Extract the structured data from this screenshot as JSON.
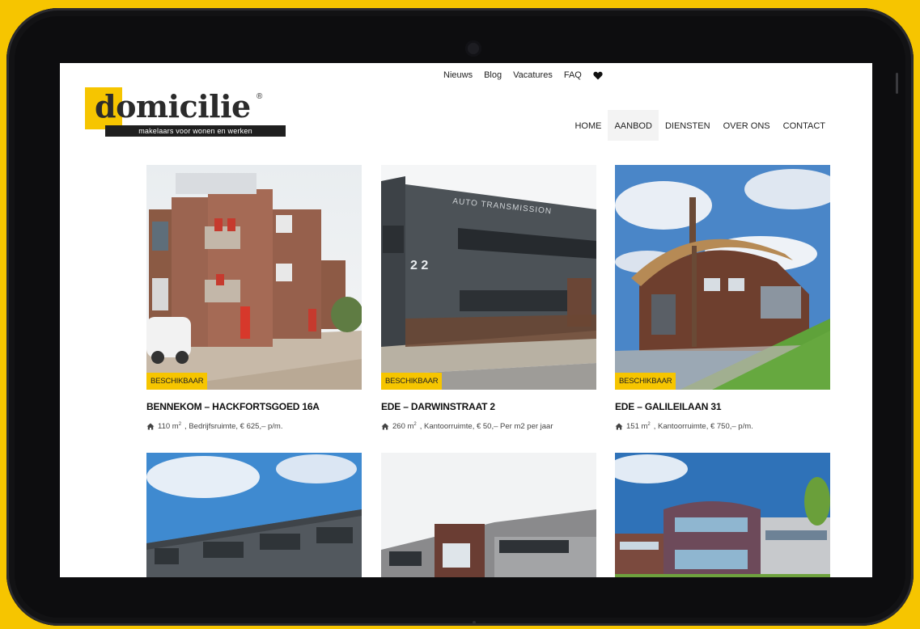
{
  "topnav": [
    {
      "label": "Nieuws"
    },
    {
      "label": "Blog"
    },
    {
      "label": "Vacatures"
    },
    {
      "label": "FAQ"
    }
  ],
  "logo": {
    "word": "domicilie",
    "registered": "®",
    "tagline": "makelaars voor wonen en werken"
  },
  "mainnav": [
    {
      "label": "HOME",
      "active": false
    },
    {
      "label": "AANBOD",
      "active": true
    },
    {
      "label": "DIENSTEN",
      "active": false
    },
    {
      "label": "OVER ONS",
      "active": false
    },
    {
      "label": "CONTACT",
      "active": false
    }
  ],
  "listings": [
    {
      "status": "BESCHIKBAAR",
      "title": "BENNEKOM – HACKFORTSGOED 16A",
      "area": "110 m",
      "area_sup": "2",
      "details": ", Bedrijfsruimte, € 625,– p/m."
    },
    {
      "status": "BESCHIKBAAR",
      "title": "EDE – DARWINSTRAAT 2",
      "area": "260 m",
      "area_sup": "2",
      "details": ", Kantoorruimte, € 50,– Per m2 per jaar"
    },
    {
      "status": "BESCHIKBAAR",
      "title": "EDE – GALILEILAAN 31",
      "area": "151 m",
      "area_sup": "2",
      "details": ", Kantoorruimte, € 750,– p/m."
    }
  ],
  "photo_labels": {
    "building2_sign": "AUTO TRANSMISSION",
    "building2_number": "2 2"
  },
  "colors": {
    "brand_yellow": "#f6c500",
    "text_dark": "#222222"
  },
  "icons": {
    "wishlist": "heart-icon",
    "property": "home-icon"
  }
}
